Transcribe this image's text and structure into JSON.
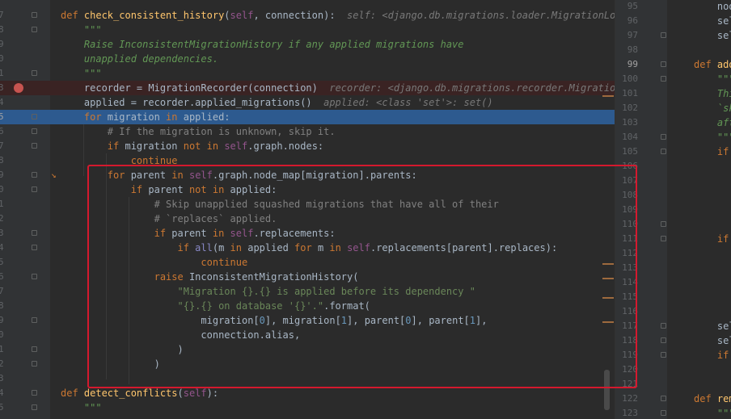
{
  "editor": {
    "left": {
      "lines": [
        {
          "n": "7",
          "code": [
            {
              "t": "def ",
              "c": "kw"
            },
            {
              "t": "check_consistent_history",
              "c": "fn"
            },
            {
              "t": "(",
              "c": "pl"
            },
            {
              "t": "self",
              "c": "sf"
            },
            {
              "t": ", connection):  ",
              "c": "pl"
            },
            {
              "t": "self: <django.db.migrations.loader.MigrationLoade",
              "c": "hint"
            }
          ]
        },
        {
          "n": "8",
          "code": [
            {
              "t": "    \"\"\"",
              "c": "doc"
            }
          ]
        },
        {
          "n": "9",
          "code": [
            {
              "t": "    Raise InconsistentMigrationHistory if any applied migrations have",
              "c": "doc"
            }
          ]
        },
        {
          "n": "0",
          "code": [
            {
              "t": "    unapplied dependencies.",
              "c": "doc"
            }
          ]
        },
        {
          "n": "1",
          "code": [
            {
              "t": "    \"\"\"",
              "c": "doc"
            }
          ]
        },
        {
          "n": "3",
          "code": [
            {
              "t": "    recorder = MigrationRecorder(connection)  ",
              "c": "pl"
            },
            {
              "t": "recorder: <django.db.migrations.recorder.MigrationRe",
              "c": "hint"
            }
          ]
        },
        {
          "n": "4",
          "code": [
            {
              "t": "    applied = recorder.applied_migrations()  ",
              "c": "pl"
            },
            {
              "t": "applied: <class 'set'>: set()",
              "c": "hint"
            }
          ]
        },
        {
          "n": "5",
          "code": [
            {
              "t": "    for ",
              "c": "kw"
            },
            {
              "t": "migration ",
              "c": "pl"
            },
            {
              "t": "in ",
              "c": "kw"
            },
            {
              "t": "applied:",
              "c": "pl"
            }
          ]
        },
        {
          "n": "6",
          "code": [
            {
              "t": "        # If the migration is unknown, skip it.",
              "c": "cmt"
            }
          ]
        },
        {
          "n": "7",
          "code": [
            {
              "t": "        if ",
              "c": "kw"
            },
            {
              "t": "migration ",
              "c": "pl"
            },
            {
              "t": "not in ",
              "c": "kw"
            },
            {
              "t": "self",
              "c": "sf"
            },
            {
              "t": ".graph.nodes:",
              "c": "pl"
            }
          ]
        },
        {
          "n": "8",
          "code": [
            {
              "t": "            continue",
              "c": "kw"
            }
          ]
        },
        {
          "n": "9",
          "code": [
            {
              "t": "        for ",
              "c": "kw"
            },
            {
              "t": "parent ",
              "c": "pl"
            },
            {
              "t": "in ",
              "c": "kw"
            },
            {
              "t": "self",
              "c": "sf"
            },
            {
              "t": ".graph.node_map[migration].parents:",
              "c": "pl"
            }
          ]
        },
        {
          "n": "0",
          "code": [
            {
              "t": "            if ",
              "c": "kw"
            },
            {
              "t": "parent ",
              "c": "pl"
            },
            {
              "t": "not in ",
              "c": "kw"
            },
            {
              "t": "applied:",
              "c": "pl"
            }
          ]
        },
        {
          "n": "1",
          "code": [
            {
              "t": "                # Skip unapplied squashed migrations that have all of their",
              "c": "cmt"
            }
          ]
        },
        {
          "n": "2",
          "code": [
            {
              "t": "                # `replaces` applied.",
              "c": "cmt"
            }
          ]
        },
        {
          "n": "3",
          "code": [
            {
              "t": "                if ",
              "c": "kw"
            },
            {
              "t": "parent ",
              "c": "pl"
            },
            {
              "t": "in ",
              "c": "kw"
            },
            {
              "t": "self",
              "c": "sf"
            },
            {
              "t": ".replacements:",
              "c": "pl"
            }
          ]
        },
        {
          "n": "4",
          "code": [
            {
              "t": "                    if ",
              "c": "kw"
            },
            {
              "t": "all",
              "c": "bi"
            },
            {
              "t": "(m ",
              "c": "pl"
            },
            {
              "t": "in ",
              "c": "kw"
            },
            {
              "t": "applied ",
              "c": "pl"
            },
            {
              "t": "for ",
              "c": "kw"
            },
            {
              "t": "m ",
              "c": "pl"
            },
            {
              "t": "in ",
              "c": "kw"
            },
            {
              "t": "self",
              "c": "sf"
            },
            {
              "t": ".replacements[parent].replaces):",
              "c": "pl"
            }
          ]
        },
        {
          "n": "5",
          "code": [
            {
              "t": "                        continue",
              "c": "kw"
            }
          ]
        },
        {
          "n": "6",
          "code": [
            {
              "t": "                raise ",
              "c": "kw"
            },
            {
              "t": "InconsistentMigrationHistory(",
              "c": "pl"
            }
          ]
        },
        {
          "n": "7",
          "code": [
            {
              "t": "                    \"Migration {}.{} is applied before its dependency \"",
              "c": "str"
            }
          ]
        },
        {
          "n": "8",
          "code": [
            {
              "t": "                    \"{}.{} on database '{}'.\"",
              "c": "str"
            },
            {
              "t": ".format(",
              "c": "pl"
            }
          ]
        },
        {
          "n": "9",
          "code": [
            {
              "t": "                        migration[",
              "c": "pl"
            },
            {
              "t": "0",
              "c": "num"
            },
            {
              "t": "], migration[",
              "c": "pl"
            },
            {
              "t": "1",
              "c": "num"
            },
            {
              "t": "], parent[",
              "c": "pl"
            },
            {
              "t": "0",
              "c": "num"
            },
            {
              "t": "], parent[",
              "c": "pl"
            },
            {
              "t": "1",
              "c": "num"
            },
            {
              "t": "],",
              "c": "pl"
            }
          ]
        },
        {
          "n": "0",
          "code": [
            {
              "t": "                        connection.alias,",
              "c": "pl"
            }
          ]
        },
        {
          "n": "1",
          "code": [
            {
              "t": "                    )",
              "c": "pl"
            }
          ]
        },
        {
          "n": "2",
          "code": [
            {
              "t": "                )",
              "c": "pl"
            }
          ]
        },
        {
          "n": "3",
          "code": []
        },
        {
          "n": "4",
          "code": [
            {
              "t": "def ",
              "c": "kw"
            },
            {
              "t": "detect_conflicts",
              "c": "fn"
            },
            {
              "t": "(",
              "c": "pl"
            },
            {
              "t": "self",
              "c": "sf"
            },
            {
              "t": "):",
              "c": "pl"
            }
          ]
        },
        {
          "n": "5",
          "code": [
            {
              "t": "    \"\"\"",
              "c": "doc"
            }
          ]
        }
      ]
    },
    "right": {
      "lines": [
        {
          "n": "95",
          "code": [
            {
              "t": "    nod",
              "c": "pl"
            }
          ]
        },
        {
          "n": "96",
          "code": [
            {
              "t": "    sel",
              "c": "pl"
            }
          ]
        },
        {
          "n": "97",
          "code": [
            {
              "t": "    sel",
              "c": "pl"
            }
          ]
        },
        {
          "n": "98",
          "code": []
        },
        {
          "n": "99",
          "code": [
            {
              "t": "def ",
              "c": "kw"
            },
            {
              "t": "add",
              "c": "fn"
            }
          ]
        },
        {
          "n": "100",
          "code": [
            {
              "t": "    \"\"\"",
              "c": "doc"
            }
          ]
        },
        {
          "n": "101",
          "code": [
            {
              "t": "    Thi",
              "c": "doc"
            }
          ]
        },
        {
          "n": "102",
          "code": [
            {
              "t": "    `sk",
              "c": "doc"
            }
          ]
        },
        {
          "n": "103",
          "code": [
            {
              "t": "    aft",
              "c": "doc"
            }
          ]
        },
        {
          "n": "104",
          "code": [
            {
              "t": "    \"\"\"",
              "c": "doc"
            }
          ]
        },
        {
          "n": "105",
          "code": [
            {
              "t": "    if ",
              "c": "kw"
            }
          ]
        },
        {
          "n": "106",
          "code": []
        },
        {
          "n": "107",
          "code": []
        },
        {
          "n": "108",
          "code": []
        },
        {
          "n": "109",
          "code": []
        },
        {
          "n": "110",
          "code": []
        },
        {
          "n": "111",
          "code": [
            {
              "t": "    if ",
              "c": "kw"
            }
          ]
        },
        {
          "n": "112",
          "code": []
        },
        {
          "n": "113",
          "code": []
        },
        {
          "n": "114",
          "code": []
        },
        {
          "n": "115",
          "code": []
        },
        {
          "n": "116",
          "code": []
        },
        {
          "n": "117",
          "code": [
            {
              "t": "    sel",
              "c": "pl"
            }
          ]
        },
        {
          "n": "118",
          "code": [
            {
              "t": "    sel",
              "c": "pl"
            }
          ]
        },
        {
          "n": "119",
          "code": [
            {
              "t": "    if ",
              "c": "kw"
            }
          ]
        },
        {
          "n": "120",
          "code": []
        },
        {
          "n": "121",
          "code": []
        },
        {
          "n": "122",
          "code": [
            {
              "t": "def ",
              "c": "kw"
            },
            {
              "t": "rem",
              "c": "fn"
            }
          ]
        },
        {
          "n": "123",
          "code": [
            {
              "t": "    \"\"\"",
              "c": "doc"
            }
          ]
        }
      ]
    }
  },
  "colors": {
    "background": "#2b2b2b",
    "gutter": "#313335",
    "execution_line": "#2d5a8f",
    "breakpoint_line": "#3a2323",
    "breakpoint": "#c75450",
    "annotation_box": "#d4192e"
  }
}
